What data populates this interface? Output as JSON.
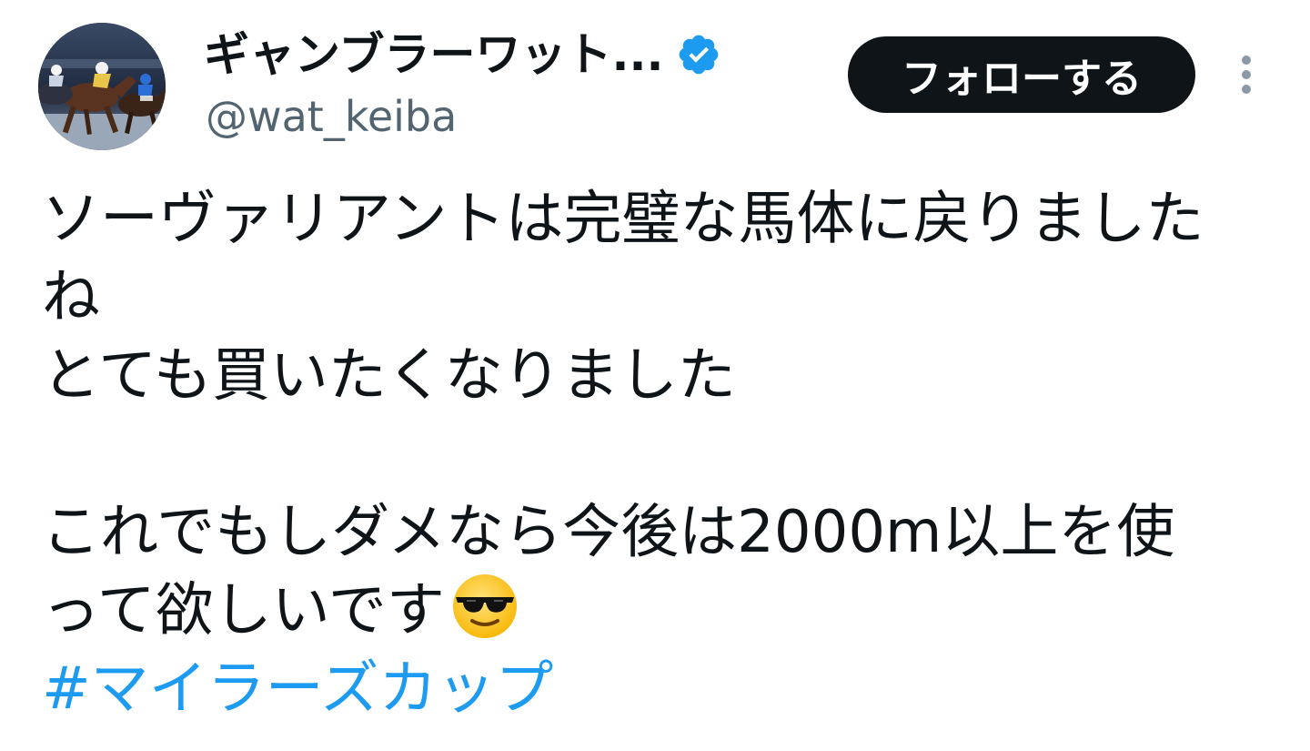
{
  "author": {
    "display_name": "ギャンブラーワット...",
    "handle": "@wat_keiba",
    "verified": true,
    "avatar": "horse-racing-photo"
  },
  "actions": {
    "follow_label": "フォローする",
    "more_icon": "vertical-ellipsis-icon"
  },
  "tweet": {
    "lines": [
      "ソーヴァリアントは完璧な馬体に戻りました",
      "ね",
      "とても買いたくなりました",
      "",
      "これでもしダメなら今後は2000m以上を使",
      "って欲しいです"
    ],
    "emoji": "smiling-face-with-sunglasses",
    "hashtag": "#マイラーズカップ"
  },
  "colors": {
    "text": "#0f1419",
    "secondary": "#536471",
    "link": "#1d9bf0",
    "button_bg": "#0f1419",
    "verified": "#1d9bf0"
  }
}
